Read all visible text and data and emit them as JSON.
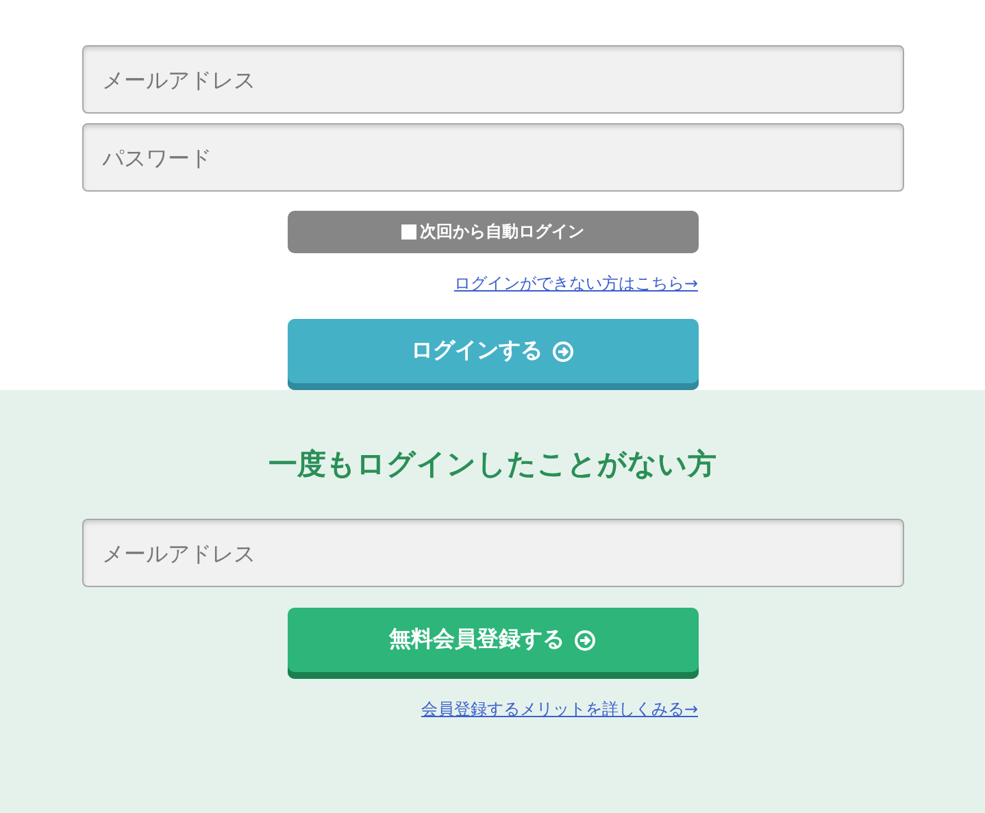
{
  "login": {
    "email": {
      "placeholder": "メールアドレス"
    },
    "password": {
      "placeholder": "パスワード"
    },
    "auto_login": {
      "label": "次回から自動ログイン",
      "checked": false
    },
    "help_link": "ログインができない方はこちら→",
    "submit": "ログインする"
  },
  "register": {
    "heading": "一度もログインしたことがない方",
    "email": {
      "placeholder": "メールアドレス"
    },
    "submit": "無料会員登録する",
    "info_link": "会員登録するメリットを詳しくみる→"
  }
}
